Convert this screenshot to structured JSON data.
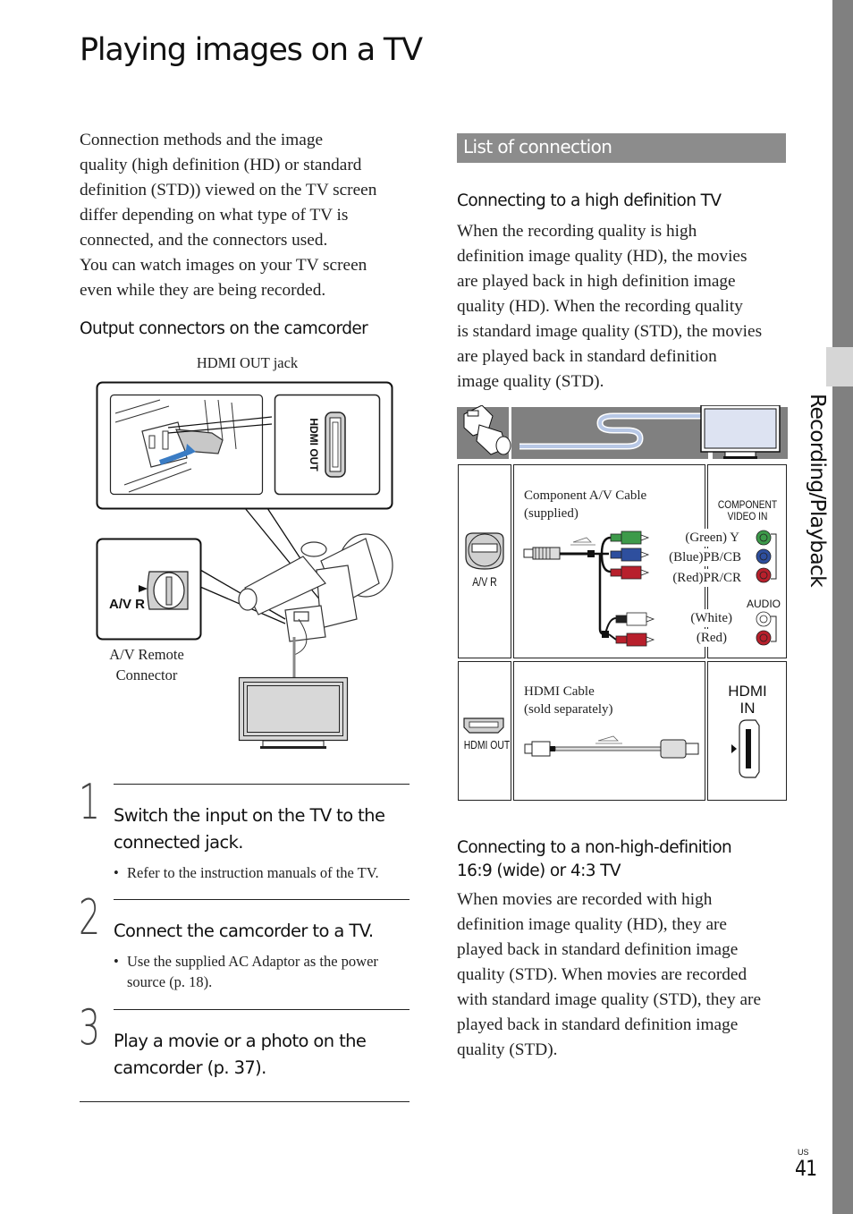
{
  "page": {
    "title": "Playing images on a TV",
    "intro": "Connection methods and the image quality (high definition (HD) or standard definition (STD)) viewed on the TV screen differ depending on what type of TV is connected, and the connectors used. You can watch images on your TV screen even while they are being recorded.",
    "intro_lines": [
      "Connection methods and the image",
      "quality (high definition (HD) or standard",
      "definition (STD)) viewed on the TV screen",
      "differ depending on what type of TV is",
      "connected, and the connectors used.",
      "You can watch images on your TV screen",
      "even while they are being recorded."
    ],
    "output_heading": "Output connectors on the camcorder",
    "figure1": {
      "hdmi_label": "HDMI OUT jack",
      "hdmi_jack_text": "HDMI OUT",
      "av_jack_text": "A/V R",
      "av_label_line1": "A/V Remote",
      "av_label_line2": "Connector"
    },
    "steps": [
      {
        "number": "1",
        "title_lines": [
          "Switch the input on the TV to the",
          "connected jack."
        ],
        "notes": [
          {
            "bullet": "•",
            "lines": [
              "Refer to the instruction manuals of the TV."
            ]
          }
        ]
      },
      {
        "number": "2",
        "title_lines": [
          "Connect the camcorder to a TV."
        ],
        "notes": [
          {
            "bullet": "•",
            "lines": [
              "Use the supplied AC Adaptor as the power",
              "source (p. 18)."
            ]
          }
        ]
      },
      {
        "number": "3",
        "title_lines": [
          "Play a movie or a photo on the",
          "camcorder (p. 37)."
        ],
        "notes": []
      }
    ],
    "section_title": "List of connection",
    "hd": {
      "heading": "Connecting to a high definition TV",
      "lines": [
        "When the recording quality is high",
        "definition image quality (HD), the movies",
        "are played back in high definition image",
        "quality (HD). When the recording quality",
        "is standard image quality (STD), the movies",
        "are played back in standard definition",
        "image quality (STD)."
      ]
    },
    "figure2": {
      "component_cable_line1": "Component A/V Cable",
      "component_cable_line2": "(supplied)",
      "camcorder_av_jack": "A/V   R",
      "component_in_line1": "COMPONENT",
      "component_in_line2": "VIDEO IN",
      "audio_label": "AUDIO",
      "plugs": [
        {
          "label": "(Green) Y",
          "color": "#3d9a4a"
        },
        {
          "label": "(Blue)PB/CB",
          "color": "#2e4f9e"
        },
        {
          "label": "(Red)PR/CR",
          "color": "#b8202c"
        },
        {
          "label": "(White)",
          "color": "#ffffff"
        },
        {
          "label": "(Red)",
          "color": "#b8202c"
        }
      ],
      "hdmi_cable_line1": "HDMI Cable",
      "hdmi_cable_line2": "(sold separately)",
      "hdmi_out": "HDMI OUT",
      "hdmi_in_line1": "HDMI",
      "hdmi_in_line2": "IN"
    },
    "nonhd": {
      "heading_lines": [
        "Connecting to a non-high-definition",
        "16:9 (wide) or 4:3 TV"
      ],
      "lines": [
        "When movies are recorded with high",
        "definition image quality (HD), they are",
        "played back in standard definition image",
        "quality (STD). When movies are recorded",
        "with standard image quality (STD), they are",
        "played back in standard definition image",
        "quality (STD)."
      ]
    },
    "side_tab": "Recording/Playback",
    "region": "US",
    "page_number": "41"
  },
  "colors": {
    "section_bar": "#8c8c8c",
    "side_bar": "#808080",
    "cable_blue": "#b8c8e6",
    "banner_gray": "#808080"
  }
}
